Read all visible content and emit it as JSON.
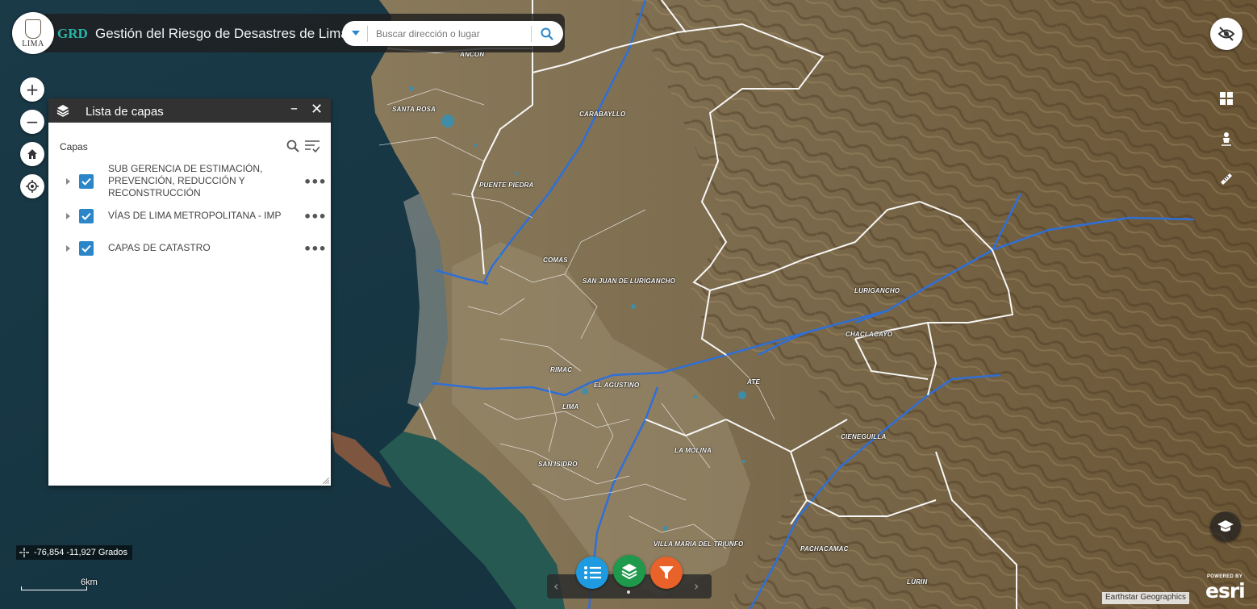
{
  "header": {
    "brand": "GRD",
    "title": "Gestión del Riesgo de Desastres de Lima",
    "logo_text": "LIMA",
    "search_placeholder": "Buscar dirección o lugar"
  },
  "map_controls": {
    "zoom_in": "+",
    "zoom_out": "−"
  },
  "layer_panel": {
    "title": "Lista de capas",
    "minimize": "–",
    "close": "✕",
    "section_label": "Capas",
    "layers": [
      {
        "label": "SUB GERENCIA DE ESTIMACIÓN, PREVENCIÓN, REDUCCIÓN Y RECONSTRUCCIÓN",
        "checked": true
      },
      {
        "label": "VÍAS DE LIMA METROPOLITANA - IMP",
        "checked": true
      },
      {
        "label": "CAPAS DE CATASTRO",
        "checked": true
      }
    ],
    "more": "•••"
  },
  "districts": [
    "ANCON",
    "SANTA ROSA",
    "CARABAYLLO",
    "PUENTE PIEDRA",
    "COMAS",
    "SAN JUAN DE LURIGANCHO",
    "LURIGANCHO",
    "CHACLACAYO",
    "RIMAC",
    "EL AGUSTINO",
    "ATE",
    "LIMA",
    "CIENEGUILLA",
    "SAN ISIDRO",
    "LA MOLINA",
    "VILLA MARIA DEL TRIUNFO",
    "PACHACAMAC",
    "LURIN"
  ],
  "coordinates": "-76,854 -11,927 Grados",
  "scale_label": "6km",
  "attribution": "Earthstar Geographics",
  "esri": {
    "powered": "POWERED BY",
    "logo": "esri"
  },
  "controller": {
    "prev": "‹",
    "next": "›"
  },
  "colors": {
    "brand_teal": "#27b6a8",
    "checkbox_blue": "#2a86c8",
    "widget_blue": "#1e9be0",
    "widget_green": "#1f9a4c",
    "widget_orange": "#e8622a",
    "river_blue": "#2f6fd6"
  },
  "icons": {
    "search": "search-icon",
    "visibility_toggle": "eye-off-icon",
    "home": "home-icon",
    "locate": "locate-icon",
    "layers": "layers-icon",
    "filter": "filter-icon",
    "list": "list-icon",
    "grid": "grid-icon",
    "person": "person-icon",
    "ruler": "ruler-icon",
    "education": "graduation-cap-icon"
  }
}
